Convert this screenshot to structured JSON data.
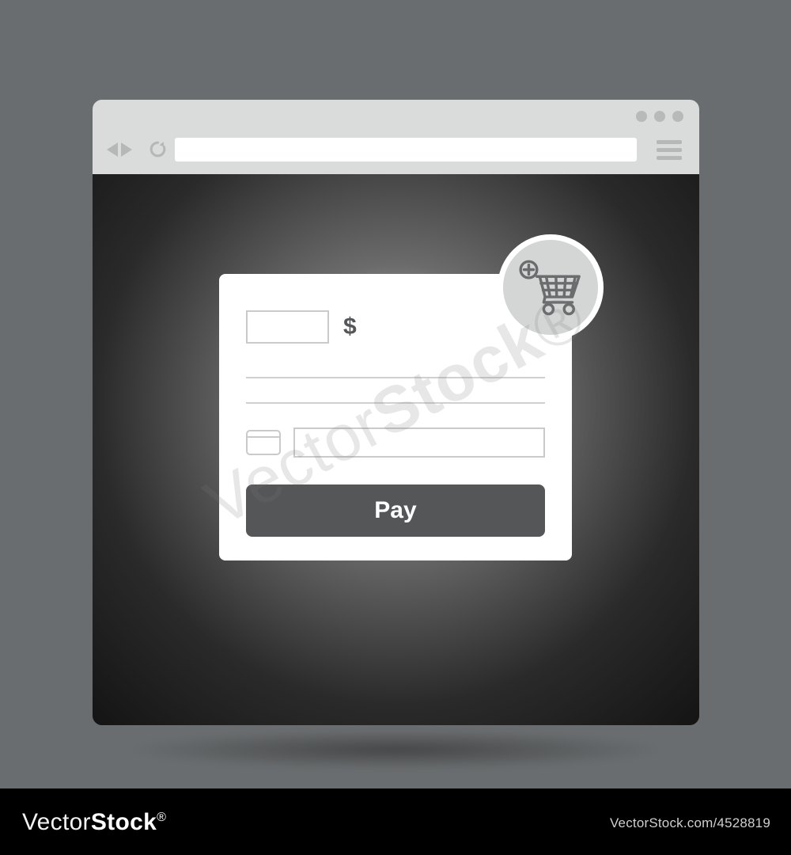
{
  "watermark": {
    "brand_thin": "Vector",
    "brand_bold": "Stock",
    "attribution": "VectorStock.com/4528819"
  },
  "browser": {
    "url_value": ""
  },
  "form": {
    "amount_value": "",
    "currency_symbol": "$",
    "line1_value": "",
    "line2_value": "",
    "card_number_value": "",
    "pay_label": "Pay"
  },
  "icons": {
    "cart": "add-to-cart-icon",
    "card": "credit-card-icon"
  }
}
